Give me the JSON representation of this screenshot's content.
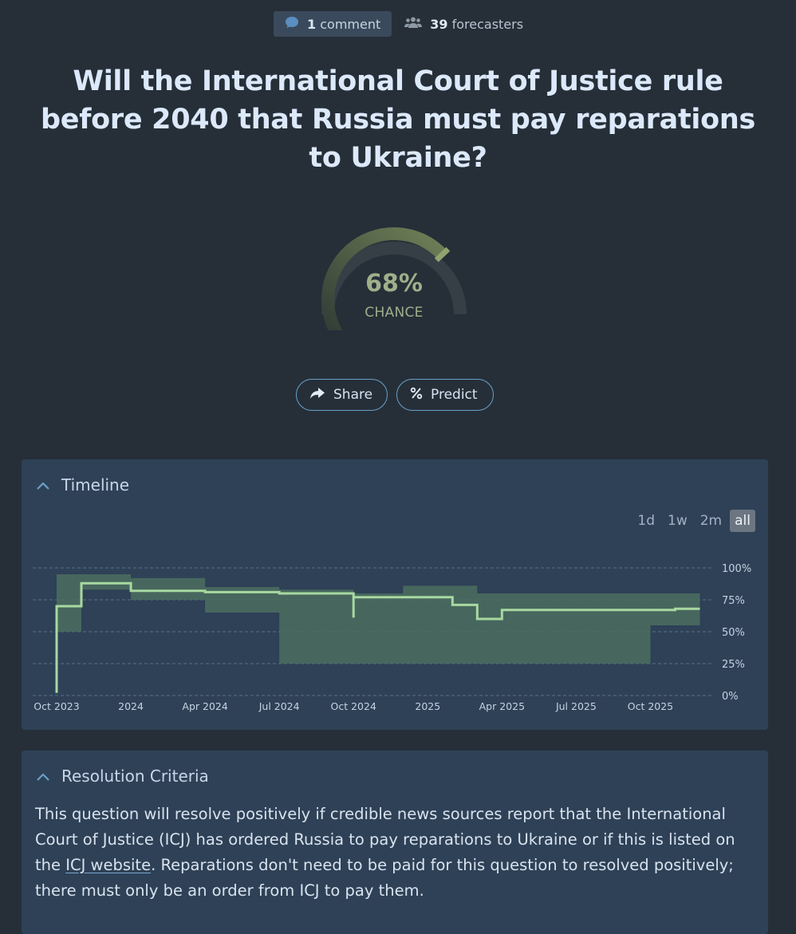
{
  "header": {
    "comments_count": "1",
    "comments_label": "comment",
    "forecasters_count": "39",
    "forecasters_label": "forecasters"
  },
  "question": {
    "title": "Will the International Court of Justice rule before 2040 that Russia must pay reparations to Ukraine?"
  },
  "prediction": {
    "value": "68%",
    "label": "CHANCE",
    "probability": 0.68
  },
  "actions": {
    "share_label": "Share",
    "predict_label": "Predict"
  },
  "timeline": {
    "heading": "Timeline",
    "ranges": [
      "1d",
      "1w",
      "2m",
      "all"
    ],
    "active_range": "all"
  },
  "chart_data": {
    "type": "line",
    "x_tick_labels": [
      "Oct 2023",
      "2024",
      "Apr 2024",
      "Jul 2024",
      "Oct 2024",
      "2025",
      "Apr 2025",
      "Jul 2025",
      "Oct 2025"
    ],
    "y_tick_labels": [
      "100%",
      "75%",
      "50%",
      "25%",
      "0%"
    ],
    "ylim": [
      0,
      100
    ],
    "grid": true,
    "series": [
      {
        "color": "#a8d8a0",
        "points": [
          [
            "Oct 2023",
            2
          ],
          [
            "Oct 2023",
            65
          ],
          [
            "Oct 2023",
            70
          ],
          [
            "Nov 2023",
            70
          ],
          [
            "Nov 2023",
            88
          ],
          [
            "Jan 2024",
            89
          ],
          [
            "Jan 2024",
            82
          ],
          [
            "Apr 2024",
            81
          ],
          [
            "Jul 2024",
            80
          ],
          [
            "Oct 2024",
            78
          ],
          [
            "Oct 2024",
            61
          ],
          [
            "Oct 2024",
            77
          ],
          [
            "Jan 2025",
            77
          ],
          [
            "Feb 2025",
            71
          ],
          [
            "Mar 2025",
            70
          ],
          [
            "Mar 2025",
            60
          ],
          [
            "Apr 2025",
            60
          ],
          [
            "Apr 2025",
            67
          ],
          [
            "Oct 2025",
            67
          ],
          [
            "Nov 2025",
            68
          ],
          [
            "Dec 2025",
            68
          ]
        ]
      }
    ],
    "band": {
      "color": "#4b6f5f",
      "upper": [
        [
          "Oct 2023",
          95
        ],
        [
          "Nov 2023",
          95
        ],
        [
          "Jan 2024",
          92
        ],
        [
          "Apr 2024",
          85
        ],
        [
          "Jul 2024",
          83
        ],
        [
          "Oct 2024",
          80
        ],
        [
          "Dec 2024",
          86
        ],
        [
          "Mar 2025",
          80
        ],
        [
          "Jul 2025",
          80
        ],
        [
          "Dec 2025",
          82
        ]
      ],
      "lower": [
        [
          "Oct 2023",
          50
        ],
        [
          "Nov 2023",
          83
        ],
        [
          "Jan 2024",
          75
        ],
        [
          "Apr 2024",
          65
        ],
        [
          "Jul 2024",
          25
        ],
        [
          "Oct 2024",
          25
        ],
        [
          "Jan 2025",
          25
        ],
        [
          "Apr 2025",
          25
        ],
        [
          "Oct 2025",
          25
        ],
        [
          "Oct 2025",
          55
        ],
        [
          "Dec 2025",
          55
        ]
      ]
    }
  },
  "resolution": {
    "heading": "Resolution Criteria",
    "text_before_link": "This question will resolve positively if credible news sources report that the International Court of Justice (ICJ) has ordered Russia to pay reparations to Ukraine or if this is listed on the ",
    "link_text": "ICJ website",
    "text_after_link": ". Reparations don't need to be paid for this question to resolved positively; there must only be an order from ICJ to pay them."
  },
  "colors": {
    "background": "#262f38",
    "panel": "#2e4157",
    "accent_green": "#9eb08a",
    "line_green": "#a8d8a0",
    "button_border": "#6aa0c8"
  }
}
